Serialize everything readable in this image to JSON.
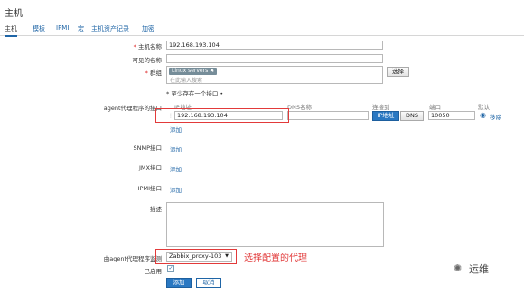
{
  "page": {
    "title": "主机"
  },
  "tabs": [
    "主机",
    "模板",
    "IPMI",
    "宏",
    "主机资产记录",
    "加密"
  ],
  "form": {
    "hostname": {
      "label": "主机名称",
      "value": "192.168.193.104"
    },
    "visible_name": {
      "label": "可见的名称",
      "value": ""
    },
    "groups": {
      "label": "群组",
      "tag": "Linux servers",
      "placeholder": "在此输入搜索",
      "select_button": "选择"
    },
    "interface_hint": "* 至少存在一个接口 •",
    "agent": {
      "label": "agent代理程序的接口",
      "headers": {
        "ip": "IP地址",
        "dns": "DNS名称",
        "connect": "连接到",
        "port": "端口",
        "default": "默认"
      },
      "ip": "192.168.193.104",
      "dns": "",
      "connect_ip": "IP地址",
      "connect_dns": "DNS",
      "port": "10050",
      "remove": "移除",
      "add": "添加"
    },
    "snmp": {
      "label": "SNMP接口",
      "add": "添加"
    },
    "jmx": {
      "label": "JMX接口",
      "add": "添加"
    },
    "ipmi": {
      "label": "IPMI接口",
      "add": "添加"
    },
    "description": {
      "label": "描述",
      "value": ""
    },
    "proxy": {
      "label": "由agent代理程序监测",
      "value": "Zabbix_proxy-103",
      "annotation": "选择配置的代理"
    },
    "enabled": {
      "label": "已启用",
      "checked": true
    },
    "buttons": {
      "add": "添加",
      "cancel": "取消"
    }
  },
  "watermark": "运维"
}
